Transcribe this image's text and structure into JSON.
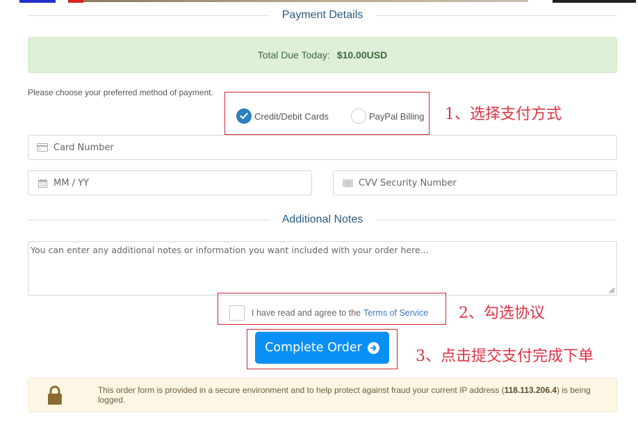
{
  "payment_section": {
    "title": "Payment Details",
    "total_label": "Total Due Today:",
    "total_amount": "$10.00USD",
    "prompt": "Please choose your preferred method of payment.",
    "methods": [
      {
        "label": "Credit/Debit Cards",
        "selected": true,
        "icon": "check-circle-icon"
      },
      {
        "label": "PayPal Billing",
        "selected": false,
        "icon": "radio-empty-icon"
      }
    ],
    "card_number_placeholder": "Card Number",
    "expiry_placeholder": "MM / YY",
    "cvv_placeholder": "CVV Security Number"
  },
  "notes_section": {
    "title": "Additional Notes",
    "placeholder": "You can enter any additional notes or information you want included with your order here..."
  },
  "terms": {
    "label": "I have read and agree to the",
    "link_text": "Terms of Service",
    "checked": false
  },
  "submit": {
    "label": "Complete Order",
    "icon": "arrow-circle-right-icon"
  },
  "secure_notice": {
    "text_before": "This order form is provided in a secure environment and to help protect against fraud your current IP address (",
    "ip": "118.113.206.4",
    "text_after": ") is being logged.",
    "icon": "lock-icon"
  },
  "annotations": {
    "step1": "1、选择支付方式",
    "step2": "2、勾选协议",
    "step3": "3、点击提交支付完成下单",
    "color": "#dd3344"
  },
  "colors": {
    "accent": "#0a8ff5",
    "section_title": "#2a5a82",
    "success_bg": "#dff0d8",
    "warning_bg": "#fcf6e4",
    "radio_checked": "#2b7fc2",
    "link": "#3a78c2"
  }
}
